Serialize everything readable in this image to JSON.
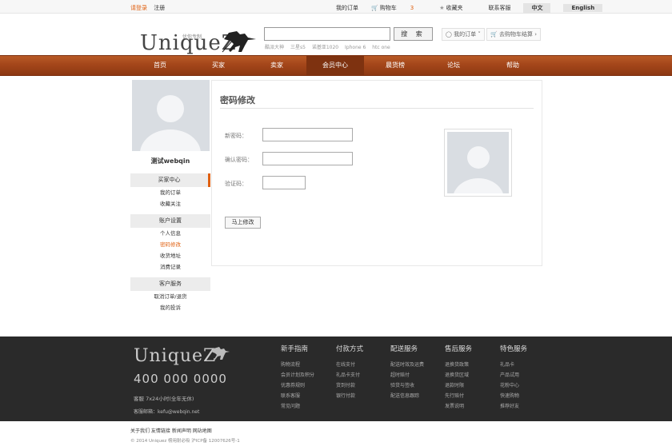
{
  "topbar": {
    "login": "请登录",
    "register": "注册",
    "links": [
      "我的订单",
      "购物车",
      "收藏夹",
      "联系客服"
    ],
    "cart_count": "3",
    "lang_cn": "中文",
    "lang_en": "English"
  },
  "header": {
    "logo": "UniqueZ",
    "logo_tagline": "优你专制",
    "search_button": "搜 索",
    "hotwords": [
      "酷派大神",
      "三星s5",
      "诺基亚1020",
      "Iphone 6",
      "htc one"
    ],
    "my_order": "我的订单",
    "cart_checkout": "去购物车结算"
  },
  "nav": [
    "首页",
    "买家",
    "卖家",
    "会员中心",
    "晨货榜",
    "论坛",
    "帮助"
  ],
  "nav_active": "会员中心",
  "sidebar": {
    "username": "测试webqin",
    "sections": [
      {
        "title": "买家中心",
        "links": [
          "我的订单",
          "收藏关注"
        ]
      },
      {
        "title": "账户设置",
        "links": [
          "个人信息",
          "密码修改",
          "收货地址",
          "消费记录"
        ]
      },
      {
        "title": "客户服务",
        "links": [
          "取消订单/退货",
          "我的投诉"
        ]
      }
    ],
    "active_link": "密码修改"
  },
  "main": {
    "title": "密码修改",
    "new_password_label": "新密码：",
    "confirm_password_label": "确认密码：",
    "captcha_label": "验证码：",
    "submit": "马上修改"
  },
  "footer": {
    "logo": "UniqueZ",
    "phone": "400 000 0000",
    "service_hours": "客服 7x24小时(全年无休)",
    "email": "客服邮箱：kefu@webqin.net",
    "columns": [
      {
        "title": "新手指南",
        "links": [
          "购物流程",
          "会员计划及积分",
          "优惠券规则",
          "联系客服",
          "常见问题"
        ]
      },
      {
        "title": "付款方式",
        "links": [
          "在线支付",
          "礼品卡支付",
          "货到付款",
          "银行付款"
        ]
      },
      {
        "title": "配送服务",
        "links": [
          "配送时效及运费",
          "超时赔付",
          "验货与签收",
          "配送信息跟踪"
        ]
      },
      {
        "title": "售后服务",
        "links": [
          "退换货政策",
          "退换货区域",
          "退款时限",
          "先行赔付",
          "发票说明"
        ]
      },
      {
        "title": "特色服务",
        "links": [
          "礼品卡",
          "产品试用",
          "花粉中心",
          "快速购物",
          "推荐好友"
        ]
      }
    ],
    "bottom_links": "关于我们 友情链接 新闻声明 网站地图",
    "copyright": "© 2014 Uniquez 榜用耐必吸 沪ICP备 12007626号-1"
  }
}
